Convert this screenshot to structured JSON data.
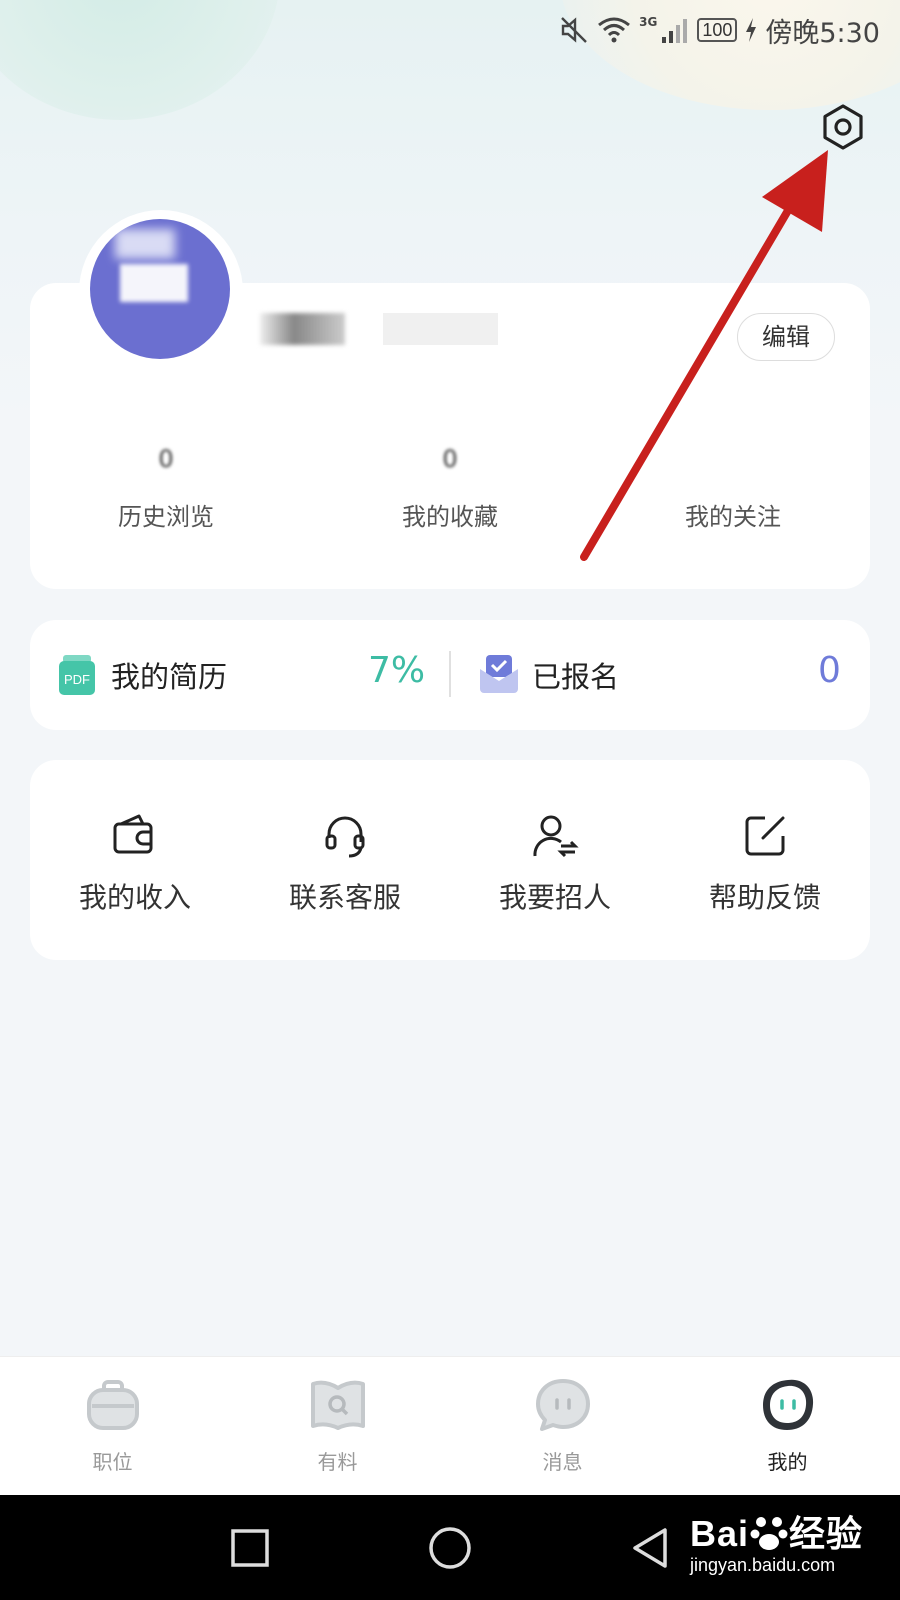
{
  "status_bar": {
    "network": "3G",
    "battery": "100",
    "time": "傍晚5:30"
  },
  "profile": {
    "edit_label": "编辑",
    "stats": [
      {
        "label": "历史浏览",
        "value": "0"
      },
      {
        "label": "我的收藏",
        "value": "0"
      },
      {
        "label": "我的关注",
        "value": ""
      }
    ]
  },
  "resume": {
    "label": "我的简历",
    "percent": "7%",
    "percent_color": "#3dbca4",
    "pdf_icon_text": "PDF",
    "applied_label": "已报名",
    "applied_count": "0",
    "applied_color": "#6f7bd9"
  },
  "tools": [
    {
      "icon": "wallet-icon",
      "label": "我的收入"
    },
    {
      "icon": "headset-icon",
      "label": "联系客服"
    },
    {
      "icon": "user-swap-icon",
      "label": "我要招人"
    },
    {
      "icon": "edit-square-icon",
      "label": "帮助反馈"
    }
  ],
  "bottom_nav": [
    {
      "icon": "briefcase-icon",
      "label": "职位",
      "active": false
    },
    {
      "icon": "book-search-icon",
      "label": "有料",
      "active": false
    },
    {
      "icon": "chat-bubble-icon",
      "label": "消息",
      "active": false
    },
    {
      "icon": "mascot-face-icon",
      "label": "我的",
      "active": true
    }
  ],
  "watermark": {
    "main": "Bai",
    "suffix": "经验",
    "url": "jingyan.baidu.com"
  },
  "colors": {
    "accent_green": "#3dbca4",
    "accent_purple": "#6f7bd9",
    "annotation_red": "#c8201d"
  }
}
